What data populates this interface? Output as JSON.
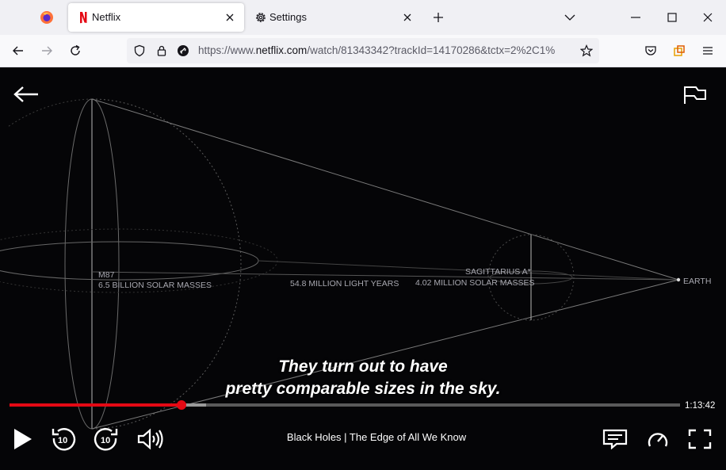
{
  "browser": {
    "tabs": [
      {
        "title": "Netflix",
        "active": true
      },
      {
        "title": "Settings",
        "active": false
      }
    ],
    "url": {
      "prefix": "https://www.",
      "domain": "netflix.com",
      "rest": "/watch/81343342?trackId=14170286&tctx=2%2C1%"
    }
  },
  "player": {
    "diagram": {
      "m87_name": "M87",
      "m87_mass": "6.5 BILLION SOLAR MASSES",
      "distance": "54.8 MILLION LIGHT YEARS",
      "sgr_name": "SAGITTARIUS A*",
      "sgr_mass": "4.02 MILLION SOLAR MASSES",
      "earth": "EARTH"
    },
    "subtitle_line1": "They turn out to have",
    "subtitle_line2": "pretty comparable sizes in the sky.",
    "time_remaining": "1:13:42",
    "progress_fraction": 0.257,
    "buffered_fraction": 0.293,
    "title": "Black Holes | The Edge of All We Know",
    "colors": {
      "accent": "#e50914",
      "text": "#ffffff",
      "background": "#050507"
    },
    "icons": [
      "back-arrow-icon",
      "report-flag-icon",
      "play-icon",
      "rewind-10-icon",
      "forward-10-icon",
      "volume-icon",
      "subtitles-icon",
      "playback-speed-icon",
      "fullscreen-icon"
    ]
  }
}
